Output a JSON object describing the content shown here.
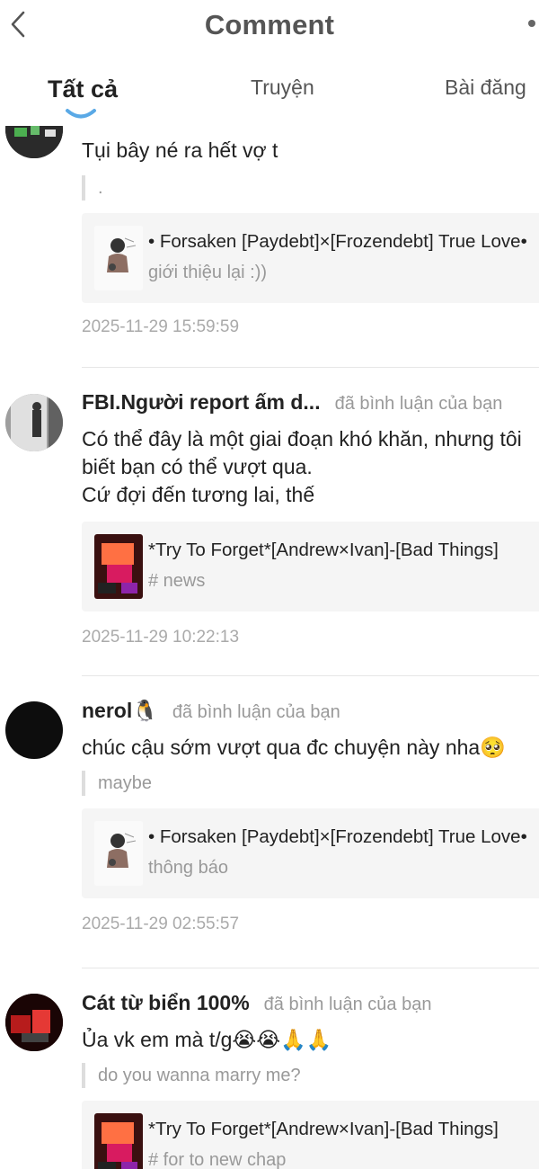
{
  "header": {
    "title": "Comment"
  },
  "tabs": [
    {
      "label": "Tất cả",
      "active": true
    },
    {
      "label": "Truyện",
      "active": false
    },
    {
      "label": "Bài đăng",
      "active": false
    }
  ],
  "comments": [
    {
      "username": "",
      "action": "",
      "text": "Tụi bây né ra hết vợ t",
      "quote": ".",
      "card": {
        "title": "• Forsaken [Paydebt]×[Frozendebt] True Love•",
        "subtitle": "giới thiệu lại :))"
      },
      "timestamp": "2025-11-29 15:59:59"
    },
    {
      "username": "FBI.Người report ấm d...",
      "action": "đã bình luận của bạn",
      "text_lines": [
        "Có thể đây là một giai đoạn khó khăn, nhưng tôi",
        "biết bạn có thể vượt qua.",
        "Cứ đợi đến tương lai, thế"
      ],
      "card": {
        "title": "*Try To Forget*[Andrew×Ivan]-[Bad Things]",
        "subtitle": "# news"
      },
      "timestamp": "2025-11-29 10:22:13"
    },
    {
      "username": "nerol🐧",
      "action": "đã bình luận của bạn",
      "text": "chúc cậu sớm vượt qua đc chuyện này nha🥺",
      "quote": "maybe",
      "card": {
        "title": "• Forsaken [Paydebt]×[Frozendebt] True Love•",
        "subtitle": "thông báo"
      },
      "timestamp": "2025-11-29 02:55:57"
    },
    {
      "username": "Cát từ biển 100%",
      "action": "đã bình luận của bạn",
      "text": "Ủa vk em mà t/g😭😭🙏🙏",
      "quote": "do you wanna marry me?",
      "card": {
        "title": "*Try To Forget*[Andrew×Ivan]-[Bad Things]",
        "subtitle": "# for to new chap"
      }
    }
  ],
  "icons": {
    "back": "back-arrow-icon",
    "more": "more-options-icon",
    "tab_indicator": "smile-curve-indicator"
  },
  "colors": {
    "title": "#555555",
    "muted": "#999999",
    "card_bg": "#f5f5f5",
    "indicator": "#5aa9e6"
  }
}
